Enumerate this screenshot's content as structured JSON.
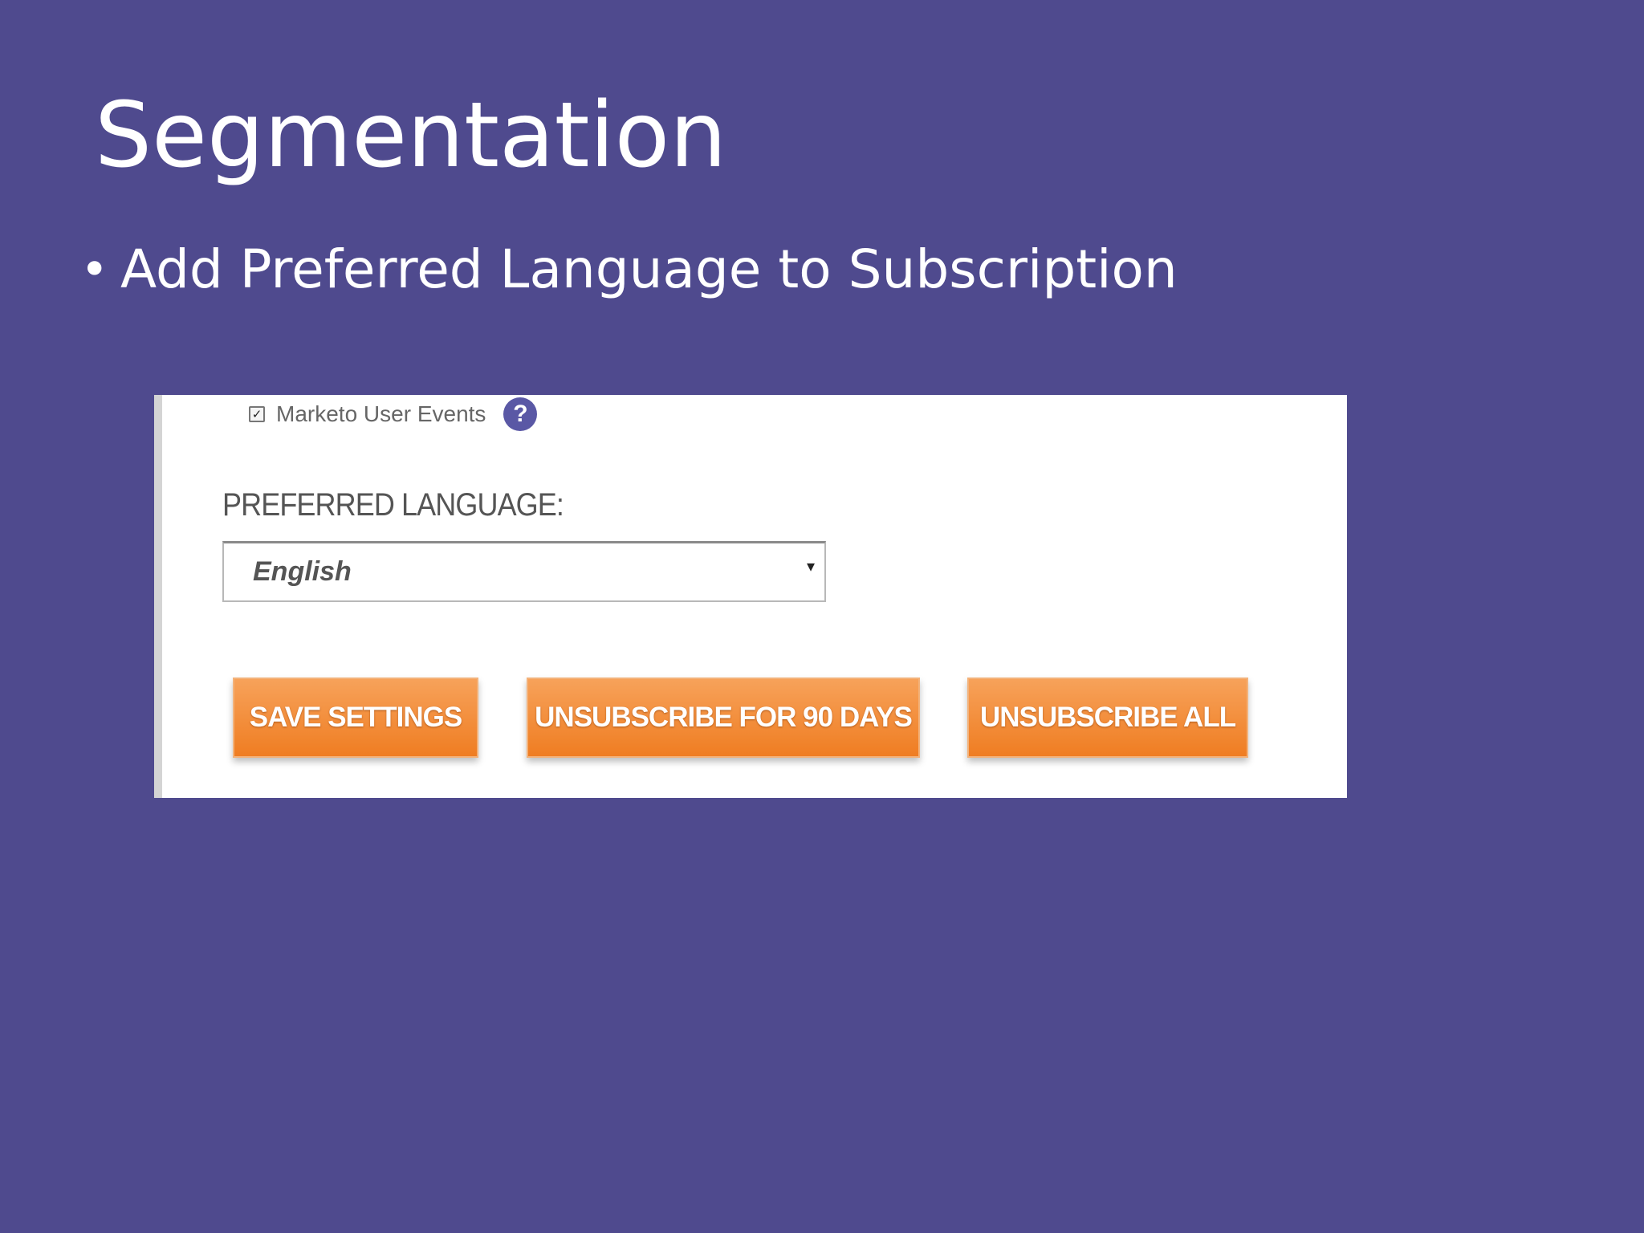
{
  "slide": {
    "title": "Segmentation",
    "bullet": "Add Preferred Language to Subscription",
    "bullet_symbol": "•",
    "background_color": "#4f4a8e"
  },
  "form": {
    "checkbox_label": "Marketo User Events",
    "checkbox_checked": true,
    "help_icon": "question-circle-icon",
    "help_icon_glyph": "?",
    "language_label": "PREFERRED LANGUAGE:",
    "language_value": "English",
    "dropdown_arrow": "▾",
    "button_color": "#ef7d22",
    "buttons": {
      "save": "SAVE SETTINGS",
      "unsubscribe_90": "UNSUBSCRIBE FOR 90 DAYS",
      "unsubscribe_all": "UNSUBSCRIBE ALL"
    }
  }
}
